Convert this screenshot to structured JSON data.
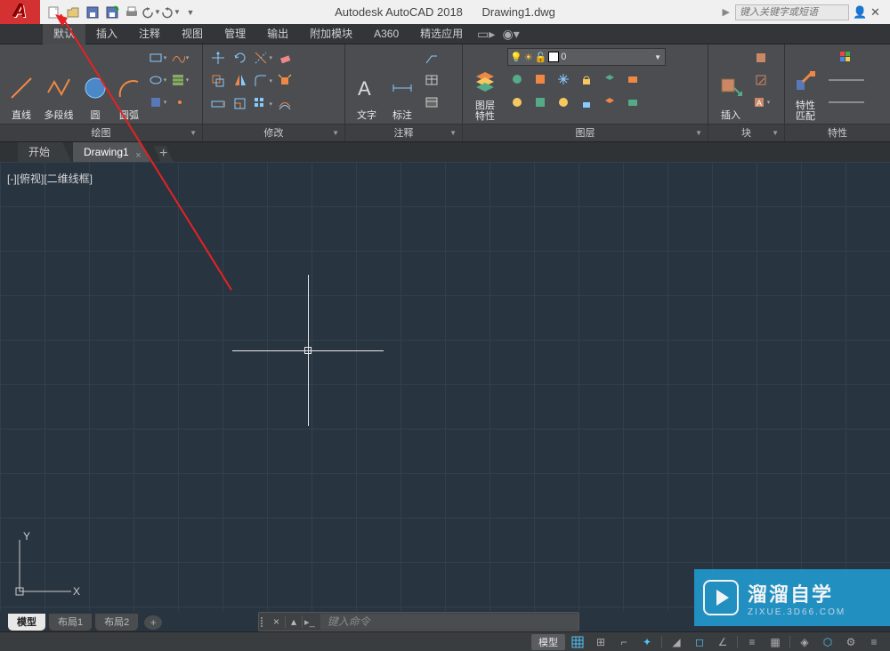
{
  "title": {
    "app": "Autodesk AutoCAD 2018",
    "doc": "Drawing1.dwg"
  },
  "search": {
    "placeholder": "键入关键字或短语"
  },
  "menu": {
    "items": [
      "默认",
      "插入",
      "注释",
      "视图",
      "管理",
      "输出",
      "附加模块",
      "A360",
      "精选应用"
    ],
    "active_index": 0
  },
  "ribbon": {
    "draw": {
      "title": "绘图",
      "line": "直线",
      "polyline": "多段线",
      "circle": "圆",
      "arc": "圆弧"
    },
    "modify": {
      "title": "修改"
    },
    "annotate": {
      "title": "注释",
      "text": "文字",
      "dim": "标注"
    },
    "layer": {
      "title": "图层",
      "props": "图层\n特性",
      "current": "0"
    },
    "block": {
      "title": "块",
      "insert": "插入"
    },
    "props": {
      "title": "特性",
      "match": "特性\n匹配"
    }
  },
  "filetabs": {
    "items": [
      "开始",
      "Drawing1"
    ],
    "active_index": 1
  },
  "canvas": {
    "view_label": "[-][俯视][二维线框]",
    "ucs_x": "X",
    "ucs_y": "Y"
  },
  "command": {
    "placeholder": "键入命令"
  },
  "layout_tabs": {
    "items": [
      "模型",
      "布局1",
      "布局2"
    ],
    "active_index": 0
  },
  "status": {
    "model": "模型"
  },
  "watermark": {
    "title": "溜溜自学",
    "url": "ZIXUE.3D66.COM"
  }
}
